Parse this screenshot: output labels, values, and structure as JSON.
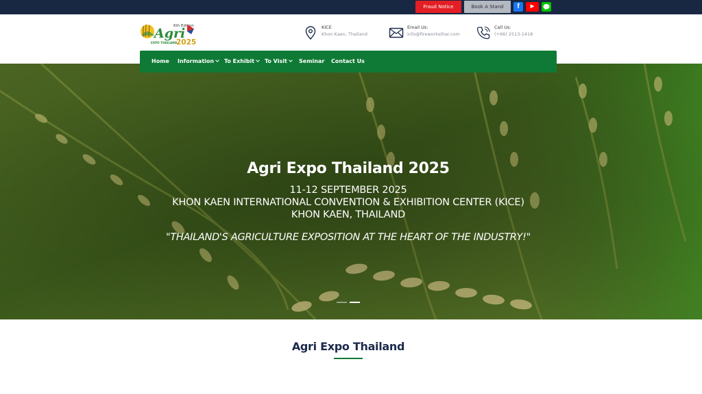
{
  "topbar": {
    "fraud_label": "Fraud Notice",
    "stand_label": "Book A Stand",
    "social": [
      {
        "name": "facebook-icon",
        "glyph": "f",
        "color": "#1877f2"
      },
      {
        "name": "youtube-icon",
        "glyph": "▶",
        "color": "#ff0000"
      },
      {
        "name": "line-icon",
        "glyph": "L",
        "color": "#00c300"
      }
    ]
  },
  "logo": {
    "edition_sup": "th",
    "edition_num": "6",
    "edition_word": "Edition",
    "main": "Agri",
    "sub": "EXPO THAILAND",
    "year": "2025"
  },
  "header": {
    "location_label": "KICE",
    "location_value": "Khon Kaen, Thailand",
    "email_label": "Email Us:",
    "email_value": "info@fireworksthai.com",
    "call_label": "Call Us:",
    "call_value": "(+66) 2513-1418"
  },
  "nav": {
    "items": [
      {
        "label": "Home",
        "dropdown": false
      },
      {
        "label": "Information",
        "dropdown": true
      },
      {
        "label": "To Exhibit",
        "dropdown": true
      },
      {
        "label": "To Visit",
        "dropdown": true
      },
      {
        "label": "Seminar",
        "dropdown": false
      },
      {
        "label": "Contact Us",
        "dropdown": false
      }
    ]
  },
  "hero": {
    "title": "Agri Expo Thailand 2025",
    "date": "11-12 SEPTEMBER 2025",
    "venue": "KHON KAEN INTERNATIONAL CONVENTION & EXHIBITION CENTER (KICE)",
    "city": "KHON KAEN, THAILAND",
    "tagline": "\"THAILAND'S AGRICULTURE EXPOSITION AT THE HEART OF THE INDUSTRY!\"",
    "slide_active": 2,
    "slide_count": 2
  },
  "section": {
    "title": "Agri Expo Thailand"
  },
  "colors": {
    "topbar": "#182742",
    "nav": "#0f7a35",
    "fraud": "#e31e24",
    "heading": "#1b2a4a"
  }
}
